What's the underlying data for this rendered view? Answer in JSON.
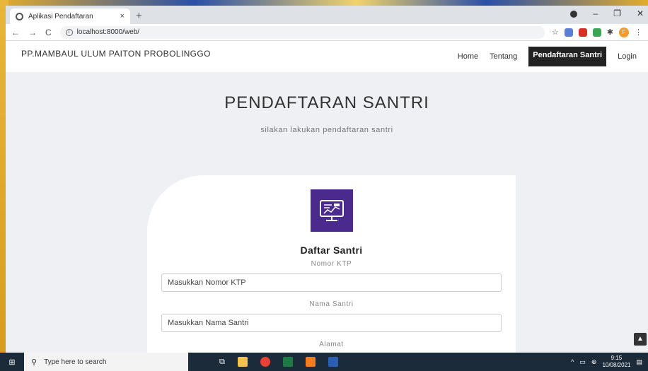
{
  "browser": {
    "tab_title": "Aplikasi Pendaftaran",
    "tab_close": "×",
    "new_tab": "+",
    "url": "localhost:8000/web/"
  },
  "navbar": {
    "brand": "PP.MAMBAUL ULUM PAITON PROBOLINGGO",
    "links": [
      "Home",
      "Tentang",
      "Pendaftaran Santri",
      "Login"
    ],
    "active": "Pendaftaran Santri"
  },
  "hero": {
    "title": "PENDAFTARAN SANTRI",
    "subtitle": "silakan lakukan pendaftaran santri"
  },
  "form": {
    "heading": "Daftar Santri",
    "fields": [
      {
        "label": "Nomor KTP",
        "placeholder": "Masukkan Nomor KTP"
      },
      {
        "label": "Nama Santri",
        "placeholder": "Masukkan Nama Santri"
      },
      {
        "label": "Alamat",
        "placeholder": ""
      }
    ]
  },
  "taskbar": {
    "search_placeholder": "Type here to search",
    "time": "9:15",
    "date": "10/08/2021"
  },
  "icons": [
    "globe-icon",
    "back-icon",
    "forward-icon",
    "reload-icon",
    "info-icon",
    "star-icon",
    "monitor-icon",
    "search-icon",
    "windows-icon",
    "chevron-up-icon"
  ],
  "colors": {
    "logo_bg": "#4a2a8c",
    "active_nav": "#222222",
    "taskbar": "#1c2b3a"
  }
}
